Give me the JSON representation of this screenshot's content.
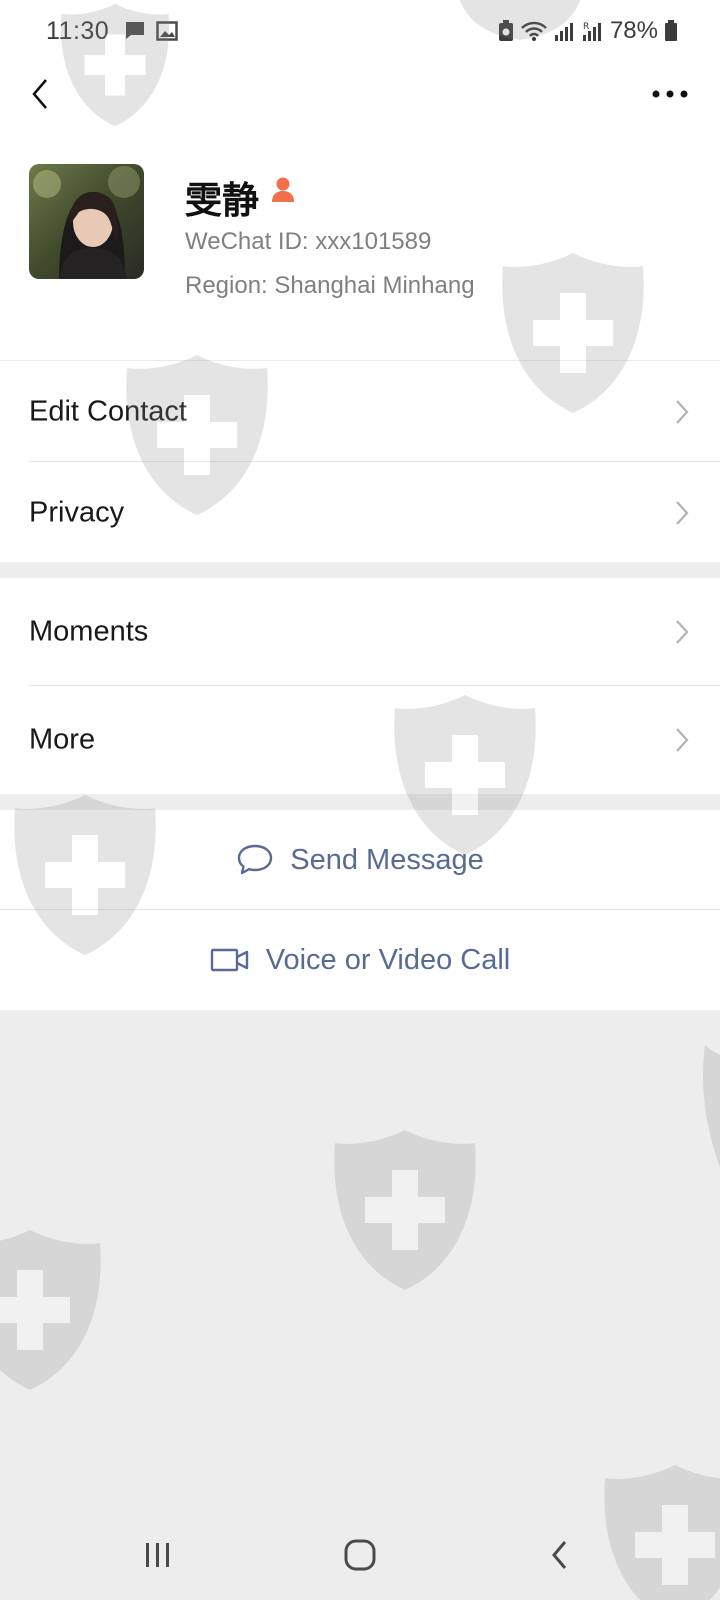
{
  "status_bar": {
    "time": "11:30",
    "battery": "78%",
    "icons": [
      "message-notification-icon",
      "image-notification-icon",
      "battery-saver-icon",
      "wifi-icon",
      "signal-icon",
      "roaming-signal-icon",
      "battery-icon"
    ]
  },
  "header": {
    "back_icon": "chevron-left-icon",
    "more_icon": "more-dots-icon"
  },
  "profile": {
    "name": "雯静",
    "gender_icon": "female-icon",
    "wechat_id": "WeChat ID:  xxx101589",
    "region": "Region:  Shanghai  Minhang"
  },
  "menu": {
    "group1": [
      {
        "label": "Edit Contact"
      },
      {
        "label": "Privacy"
      }
    ],
    "group2": [
      {
        "label": "Moments"
      },
      {
        "label": "More"
      }
    ]
  },
  "actions": {
    "send_message": "Send Message",
    "voice_video": "Voice or Video Call"
  },
  "colors": {
    "link": "#576b95",
    "background": "#ededed",
    "accent": "#f0704e"
  }
}
